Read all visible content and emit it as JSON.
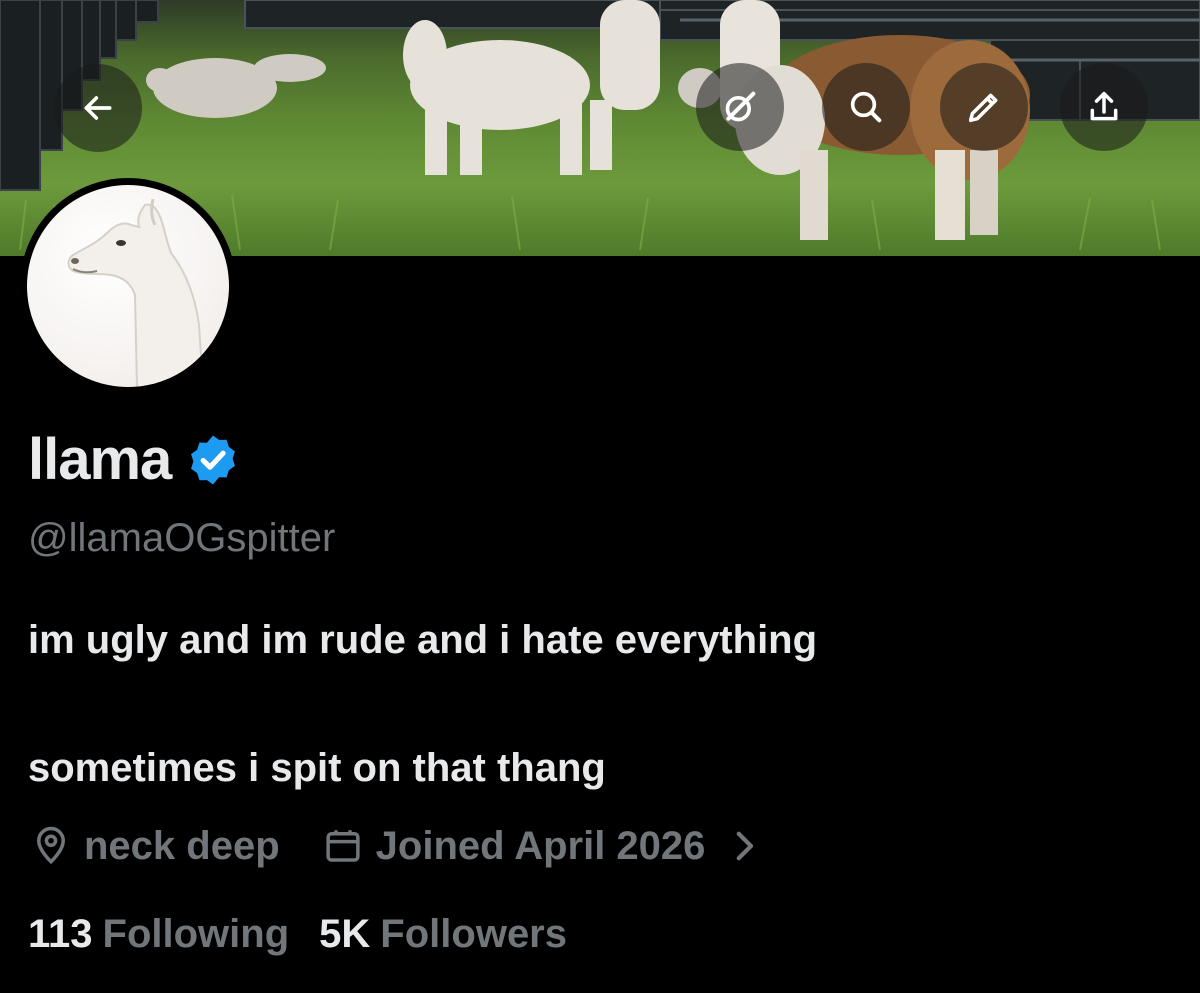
{
  "profile": {
    "display_name": "llama",
    "handle": "@llamaOGspitter",
    "verified": true,
    "bio_lines": [
      "im ugly and im rude and i hate everything",
      "sometimes i spit on that thang"
    ],
    "location": "neck deep",
    "joined": "Joined April 2026"
  },
  "stats": {
    "following_count": "113",
    "following_label": "Following",
    "followers_count": "5K",
    "followers_label": "Followers"
  },
  "icons": {
    "back": "arrow-left-icon",
    "grok": "grok-icon",
    "search": "search-icon",
    "edit": "pencil-icon",
    "share": "share-icon",
    "verified": "verified-badge-icon",
    "location": "location-pin-icon",
    "calendar": "calendar-icon",
    "chevron": "chevron-right-icon"
  },
  "colors": {
    "background": "#000000",
    "text_primary": "#e7e9ea",
    "text_secondary": "#71767b",
    "verified_blue": "#1d9bf0"
  }
}
